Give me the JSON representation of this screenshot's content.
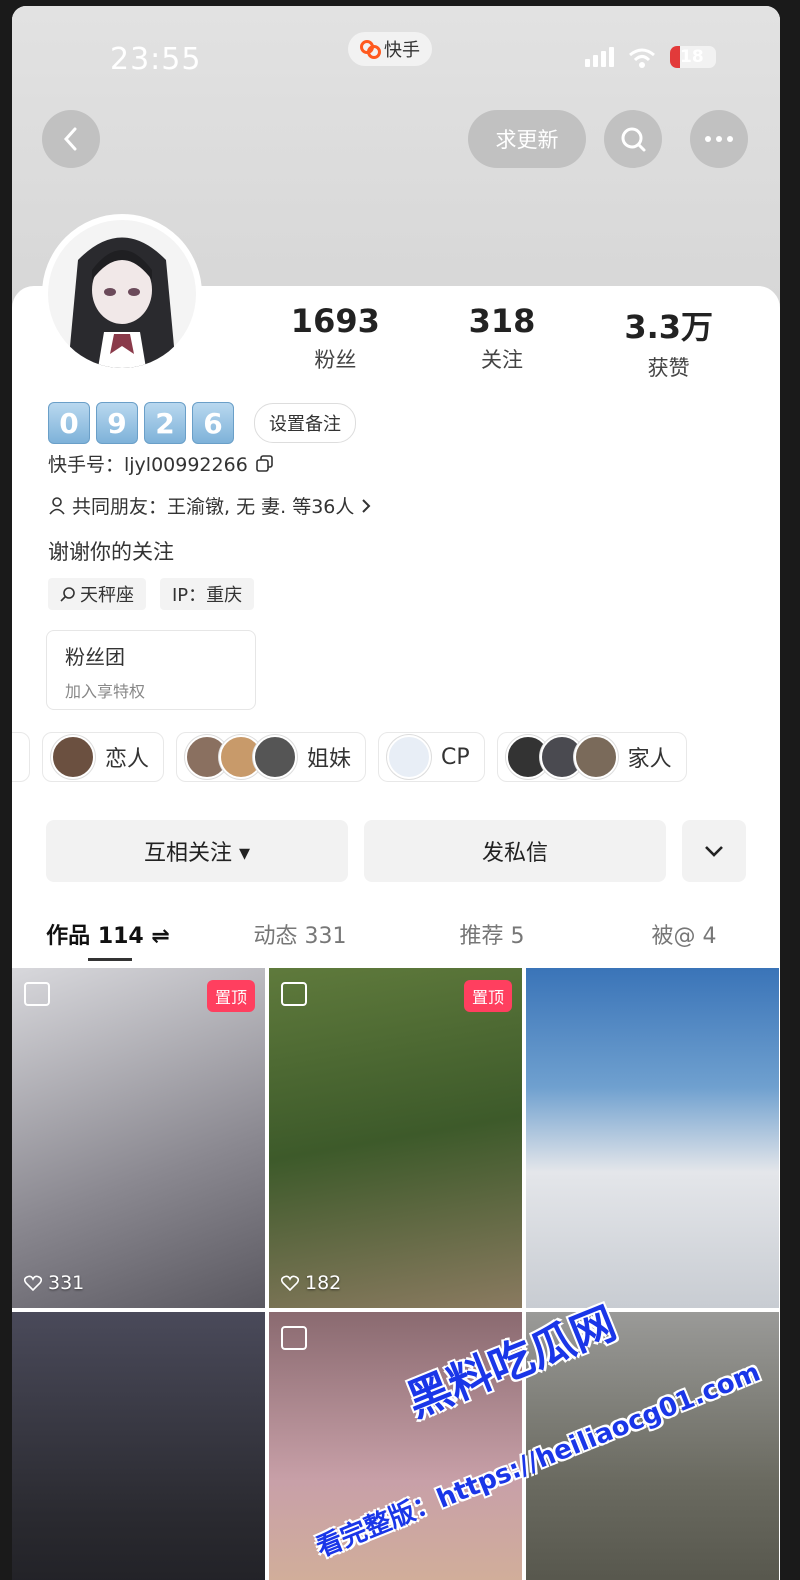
{
  "status_bar": {
    "time": "23:55",
    "app_name": "快手",
    "battery": "18"
  },
  "nav": {
    "request_update_label": "求更新"
  },
  "stats": [
    {
      "value": "1693",
      "label": "粉丝"
    },
    {
      "value": "318",
      "label": "关注"
    },
    {
      "value": "3.3万",
      "label": "获赞"
    }
  ],
  "profile": {
    "badge_digits": [
      "0",
      "9",
      "2",
      "6"
    ],
    "set_remark_label": "设置备注",
    "kuaishou_id": "快手号：ljyl00992266",
    "mutual_friends": "共同朋友：王渝镦, 无 妻. 等36人",
    "bio": "谢谢你的关注",
    "tags": [
      "天秤座",
      "IP：重庆"
    ]
  },
  "fan_club": {
    "title": "粉丝团",
    "subtitle": "加入享特权"
  },
  "relations": [
    {
      "label": "恋人"
    },
    {
      "label": "姐妹"
    },
    {
      "label": "CP"
    },
    {
      "label": "家人"
    }
  ],
  "actions": {
    "follow_label": "互相关注 ▾",
    "message_label": "发私信"
  },
  "tabs": [
    {
      "label": "作品 114 ⇌"
    },
    {
      "label": "动态 331"
    },
    {
      "label": "推荐 5"
    },
    {
      "label": "被@ 4"
    }
  ],
  "posts": [
    {
      "pinned_label": "置顶",
      "likes": "331"
    },
    {
      "pinned_label": "置顶",
      "likes": "182"
    }
  ],
  "watermark": {
    "line1": "黑料吃瓜网",
    "line2": "看完整版：https://heiliaocg01.com"
  },
  "colors": {
    "pin": "#ff3f5f",
    "digit_badge": "#7eb2d9"
  }
}
